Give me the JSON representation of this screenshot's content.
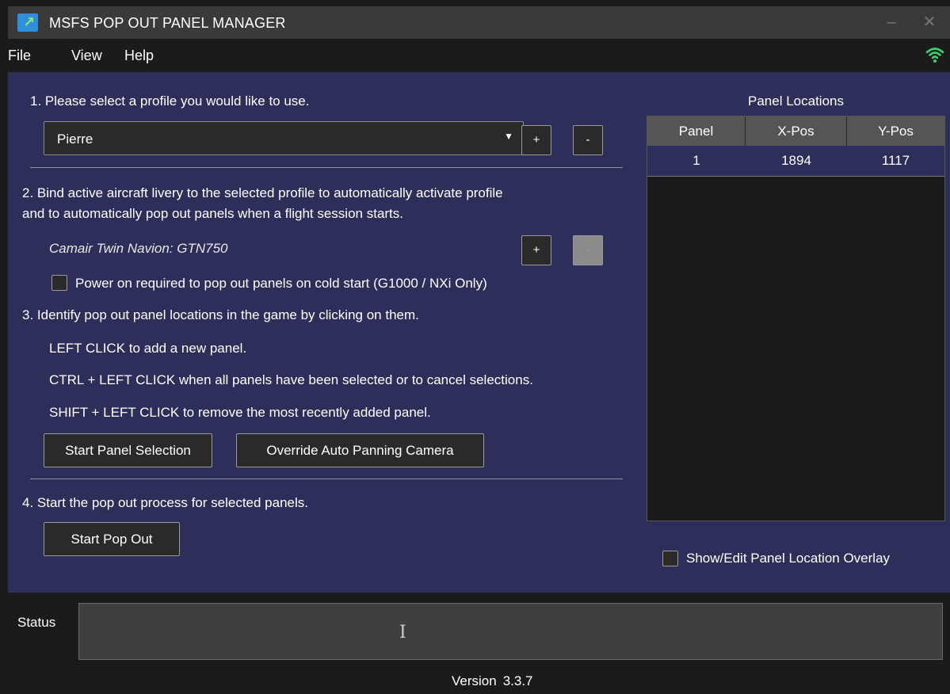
{
  "window": {
    "title": "MSFS POP OUT PANEL MANAGER",
    "minimize_glyph": "–",
    "close_glyph": "✕"
  },
  "menu": {
    "items": [
      "File",
      "View",
      "Help"
    ],
    "status_icon": "wifi-icon",
    "status_color": "#3bd16f"
  },
  "step1": {
    "instruction": "1. Please select a profile you would like to use.",
    "profile_selected": "Pierre",
    "add_label": "+",
    "remove_label": "-"
  },
  "step2": {
    "instruction_line1": "2. Bind active aircraft livery to the selected profile to automatically activate profile",
    "instruction_line2": "and to automatically pop out panels when a flight session starts.",
    "aircraft_livery": "Camair Twin Navion: GTN750",
    "add_label": "+",
    "remove_label": "-",
    "power_on_checkbox_label": "Power on required to pop out panels on cold start (G1000 / NXi Only)",
    "power_on_checked": false
  },
  "step3": {
    "instruction": "3. Identify pop out panel locations in the game by clicking on them.",
    "hint_left_click": "LEFT CLICK  to add a new panel.",
    "hint_ctrl_click": "CTRL + LEFT CLICK  when all panels have been selected or to cancel selections.",
    "hint_shift_click": "SHIFT + LEFT CLICK  to remove the most recently added panel.",
    "start_selection_label": "Start Panel Selection",
    "override_camera_label": "Override Auto Panning Camera"
  },
  "step4": {
    "instruction": "4. Start the pop out process for selected panels.",
    "start_popout_label": "Start Pop Out"
  },
  "panel_locations": {
    "title": "Panel Locations",
    "columns": [
      "Panel",
      "X-Pos",
      "Y-Pos"
    ],
    "rows": [
      {
        "panel": "1",
        "x": "1894",
        "y": "1117"
      }
    ],
    "overlay_checkbox_label": "Show/Edit Panel Location Overlay",
    "overlay_checked": false
  },
  "status": {
    "label": "Status",
    "text": ""
  },
  "footer": {
    "version_label": "Version",
    "version_number": "3.3.7"
  }
}
